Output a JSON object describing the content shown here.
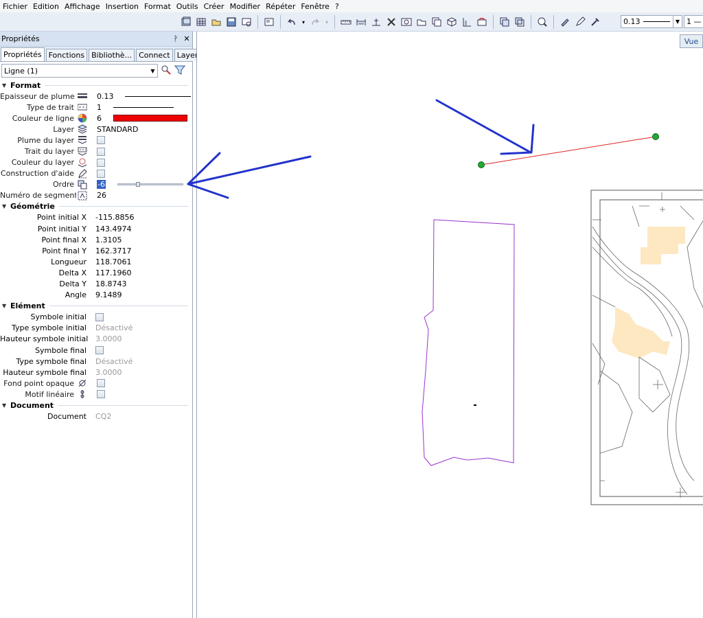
{
  "menu": [
    {
      "label": "Fichier"
    },
    {
      "label": "Edition"
    },
    {
      "label": "Affichage"
    },
    {
      "label": "Insertion"
    },
    {
      "label": "Format"
    },
    {
      "label": "Outils"
    },
    {
      "label": "Créer"
    },
    {
      "label": "Modifier"
    },
    {
      "label": "Répéter"
    },
    {
      "label": "Fenêtre"
    },
    {
      "label": "?"
    }
  ],
  "toolbar": {
    "pen_value": "0.13",
    "style_value": "1 —"
  },
  "panel": {
    "title": "Propriétés",
    "pin": "ᚹ",
    "close": "✕",
    "tabs": [
      "Propriétés",
      "Fonctions",
      "Bibliothè...",
      "Connect",
      "Layer"
    ],
    "selector": "Ligne (1)"
  },
  "format": {
    "title": "Format",
    "epaisseur_label": "Epaisseur de plume",
    "epaisseur_value": "0.13",
    "type_trait_label": "Type de trait",
    "type_trait_value": "1",
    "couleur_label": "Couleur de ligne",
    "couleur_value": "6",
    "couleur_hex": "#ee0000",
    "layer_label": "Layer",
    "layer_value": "STANDARD",
    "plume_layer_label": "Plume du layer",
    "trait_layer_label": "Trait du layer",
    "couleur_layer_label": "Couleur du layer",
    "construction_label": "Construction d'aide",
    "ordre_label": "Ordre",
    "ordre_value": "-6",
    "segment_label": "Numéro de segment",
    "segment_value": "26"
  },
  "geometrie": {
    "title": "Géométrie",
    "rows": [
      {
        "label": "Point initial X",
        "value": "-115.8856"
      },
      {
        "label": "Point initial Y",
        "value": "143.4974"
      },
      {
        "label": "Point final X",
        "value": "1.3105"
      },
      {
        "label": "Point final Y",
        "value": "162.3717"
      },
      {
        "label": "Longueur",
        "value": "118.7061"
      },
      {
        "label": "Delta X",
        "value": "117.1960"
      },
      {
        "label": "Delta Y",
        "value": "18.8743"
      },
      {
        "label": "Angle",
        "value": "9.1489"
      }
    ]
  },
  "element": {
    "title": "Elément",
    "symbole_initial_label": "Symbole initial",
    "type_symbole_initial_label": "Type symbole initial",
    "type_symbole_initial_value": "Désactivé",
    "hauteur_symbole_initial_label": "Hauteur symbole initial",
    "hauteur_symbole_initial_value": "3.0000",
    "symbole_final_label": "Symbole final",
    "type_symbole_final_label": "Type symbole final",
    "type_symbole_final_value": "Désactivé",
    "hauteur_symbole_final_label": "Hauteur symbole final",
    "hauteur_symbole_final_value": "3.0000",
    "fond_point_label": "Fond point opaque",
    "motif_label": "Motif linéaire"
  },
  "document": {
    "title": "Document",
    "label": "Document",
    "value": "CQ2"
  },
  "canvas": {
    "vue_tab": "Vue"
  },
  "colors": {
    "annotation_arrow": "#2233cc",
    "line_red": "#dd2222",
    "endpoint_green": "#22aa33",
    "polygon_purple": "#9933cc"
  }
}
